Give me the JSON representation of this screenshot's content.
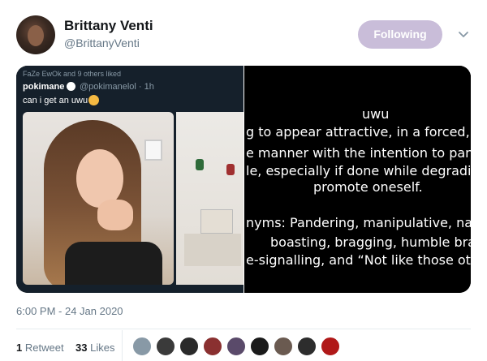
{
  "author": {
    "name": "Brittany Venti",
    "handle": "@BrittanyVenti"
  },
  "follow": {
    "label": "Following"
  },
  "quoted": {
    "liked_by": "FaZe EwOk and 9 others liked",
    "name": "pokimane",
    "handle": "@pokimanelol · 1h",
    "text": "can i get an uwu"
  },
  "definition": {
    "lines": [
      "uwu",
      "g to appear attractive, in a forced, p",
      "e manner with the intention to pand",
      "le, especially if done while degradin",
      "promote oneself.",
      "nyms: Pandering, manipulative, nar",
      "boasting, bragging, humble braggi",
      "e-signalling, and “Not like those oth"
    ]
  },
  "timestamp": "6:00 PM - 24 Jan 2020",
  "stats": {
    "retweets_count": "1",
    "retweets_label": "Retweet",
    "likes_count": "33",
    "likes_label": "Likes"
  },
  "likers": [
    {
      "icon": "default-avatar",
      "color": "#8899a6"
    },
    {
      "icon": "avatar",
      "color": "#3a3a3a"
    },
    {
      "icon": "avatar",
      "color": "#2a2a2a"
    },
    {
      "icon": "avatar",
      "color": "#8a3030"
    },
    {
      "icon": "avatar",
      "color": "#5a4a6a"
    },
    {
      "icon": "avatar",
      "color": "#1a1a1a"
    },
    {
      "icon": "avatar",
      "color": "#6a5a50"
    },
    {
      "icon": "avatar",
      "color": "#2d2d2d"
    },
    {
      "icon": "avatar",
      "color": "#b01818"
    }
  ],
  "colors": {
    "follow_bg": "#c9bdd9",
    "muted": "#657786"
  }
}
